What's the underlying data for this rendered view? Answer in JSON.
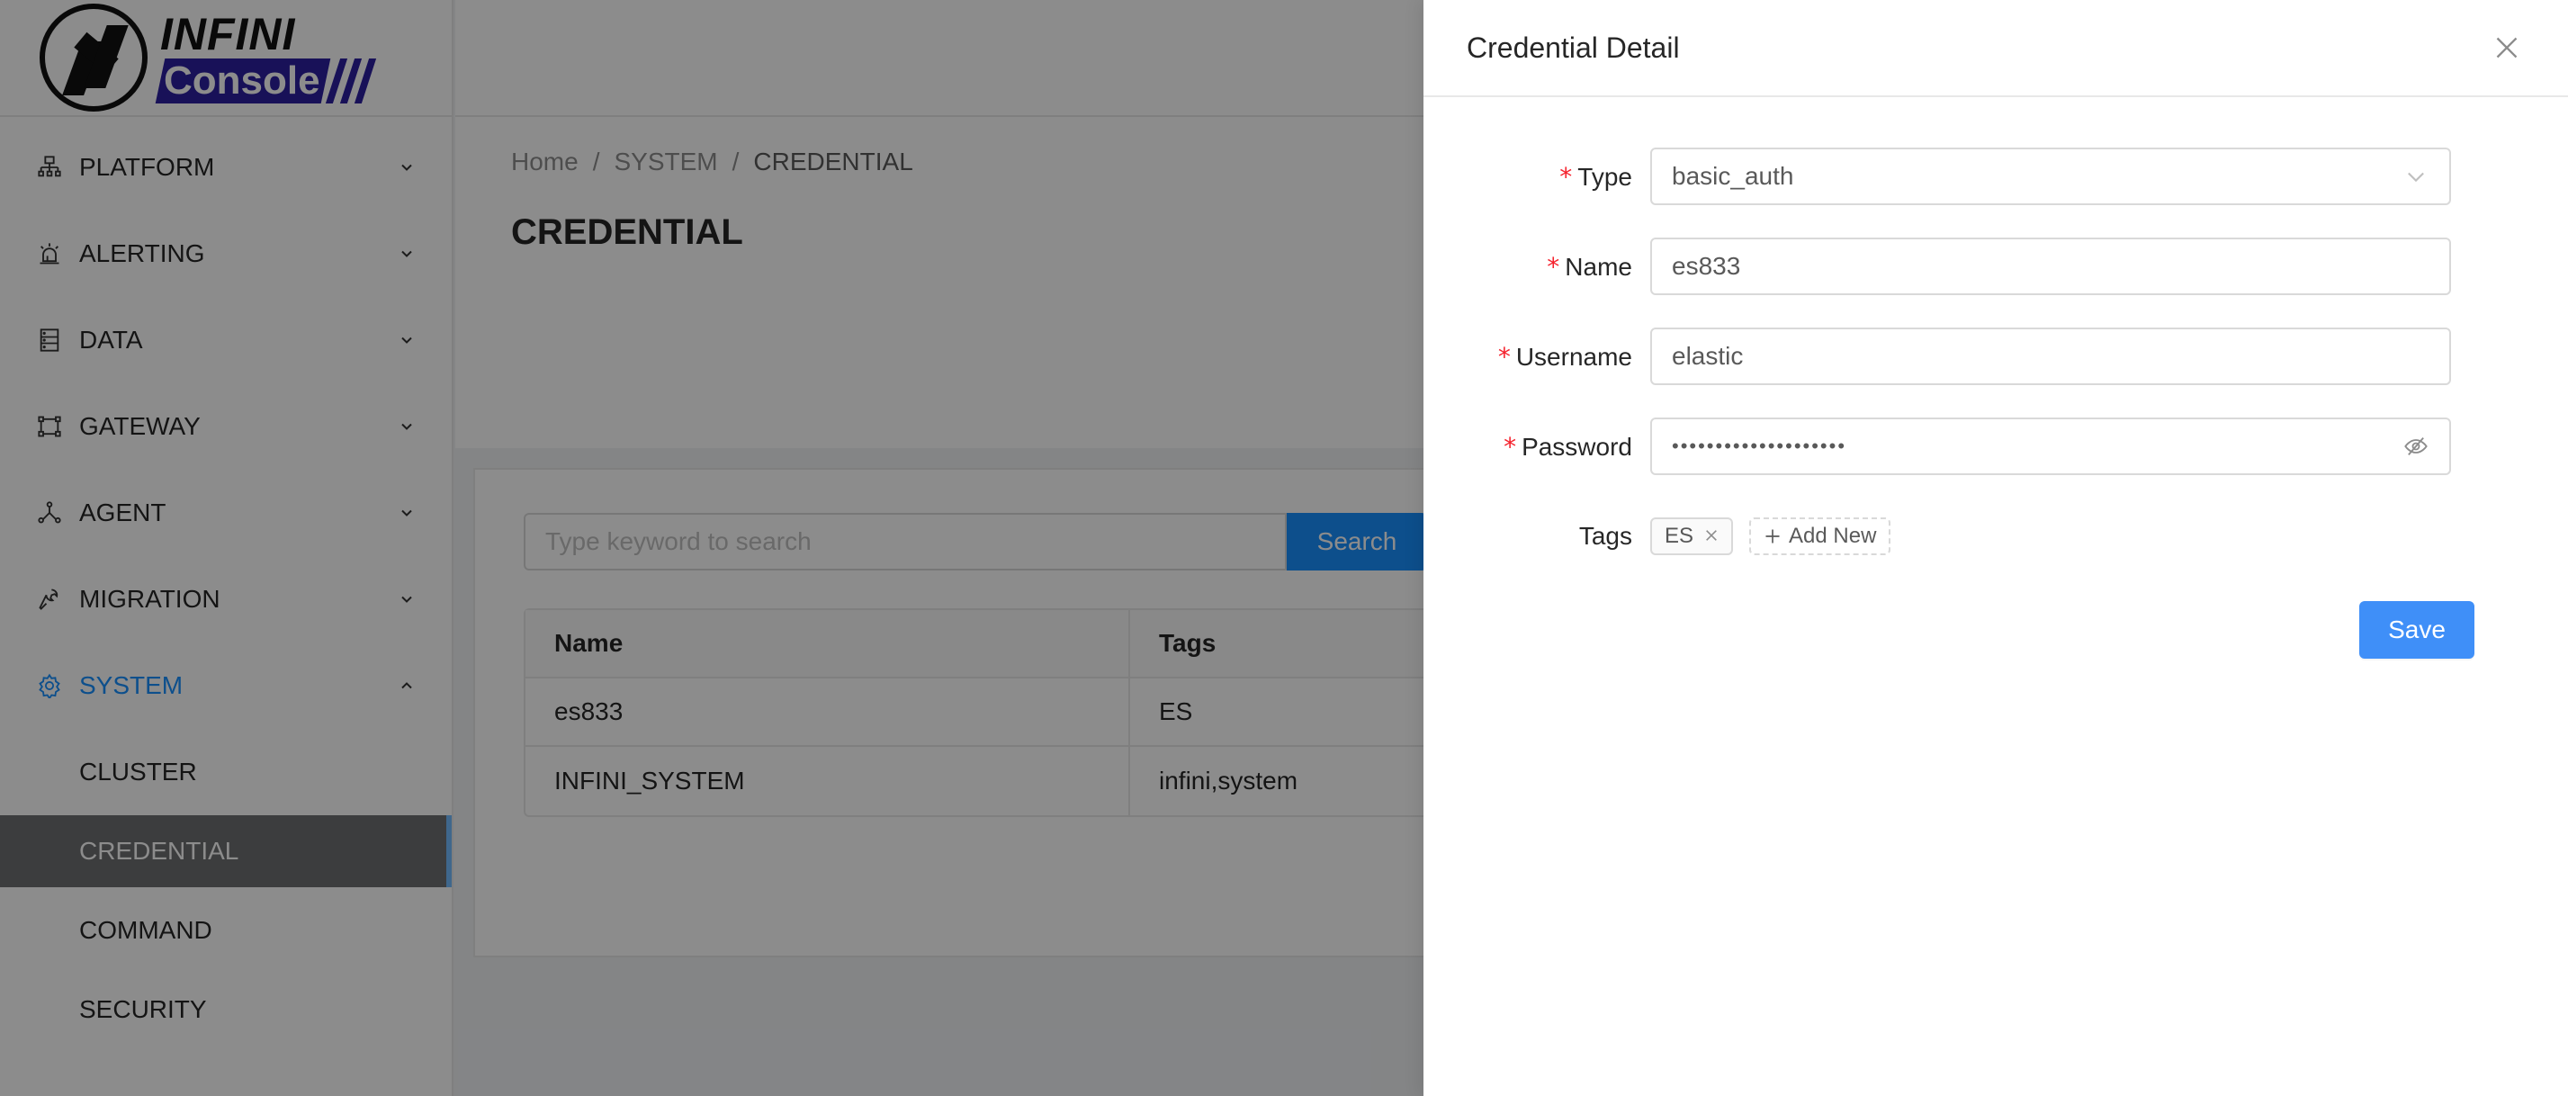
{
  "logo": {
    "line1": "INFINI",
    "line2": "Console",
    "icon": "infini-logo-icon"
  },
  "sidebar": {
    "items": [
      {
        "label": "PLATFORM",
        "icon": "sitemap-icon",
        "state": "collapsed"
      },
      {
        "label": "ALERTING",
        "icon": "alarm-icon",
        "state": "collapsed"
      },
      {
        "label": "DATA",
        "icon": "database-icon",
        "state": "collapsed"
      },
      {
        "label": "GATEWAY",
        "icon": "gateway-icon",
        "state": "collapsed"
      },
      {
        "label": "AGENT",
        "icon": "nodes-icon",
        "state": "collapsed"
      },
      {
        "label": "MIGRATION",
        "icon": "wrench-icon",
        "state": "collapsed"
      },
      {
        "label": "SYSTEM",
        "icon": "gear-icon",
        "state": "expanded"
      }
    ],
    "system_children": [
      {
        "label": "CLUSTER",
        "selected": false
      },
      {
        "label": "CREDENTIAL",
        "selected": true
      },
      {
        "label": "COMMAND",
        "selected": false
      },
      {
        "label": "SECURITY",
        "selected": false
      }
    ],
    "accent_color": "#1890ff"
  },
  "breadcrumb": [
    "Home",
    "SYSTEM",
    "CREDENTIAL"
  ],
  "breadcrumb_separator": "/",
  "page_title": "CREDENTIAL",
  "search": {
    "placeholder": "Type keyword to search",
    "value": "",
    "button_label": "Search"
  },
  "table": {
    "columns": [
      "Name",
      "Tags"
    ],
    "rows": [
      {
        "name": "es833",
        "tags": "ES"
      },
      {
        "name": "INFINI_SYSTEM",
        "tags": "infini,system"
      }
    ]
  },
  "drawer": {
    "title": "Credential Detail",
    "close_icon": "close-icon",
    "fields": {
      "type": {
        "label": "Type",
        "required": true,
        "value": "basic_auth"
      },
      "name": {
        "label": "Name",
        "required": true,
        "value": "es833"
      },
      "username": {
        "label": "Username",
        "required": true,
        "value": "elastic"
      },
      "password": {
        "label": "Password",
        "required": true,
        "masked_value": "••••••••••••••••••••",
        "visibility": "hidden"
      },
      "tags": {
        "label": "Tags",
        "values": [
          "ES"
        ],
        "add_label": "Add New"
      }
    },
    "required_marker": "*",
    "save_label": "Save",
    "save_color": "#3f8ff8"
  }
}
